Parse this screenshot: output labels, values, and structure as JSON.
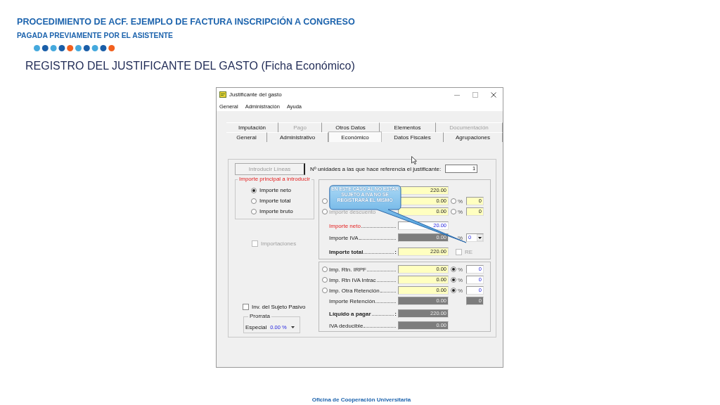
{
  "slide": {
    "title": "PROCEDIMIENTO DE ACF. EJEMPLO DE FACTURA INSCRIPCIÓN A CONGRESO",
    "subtitle": "PAGADA PREVIAMENTE POR EL ASISTENTE",
    "heading": "REGISTRO DEL JUSTIFICANTE DEL GASTO (Ficha Económico)",
    "footer": "Oficina de Cooperación Universitaria"
  },
  "window": {
    "title": "Justificante del gasto",
    "menu": [
      "General",
      "Administración",
      "Ayuda"
    ],
    "tab_rows": [
      [
        {
          "label": "Imputación",
          "selected": false,
          "disabled": false
        },
        {
          "label": "Pago",
          "selected": false,
          "disabled": true
        },
        {
          "label": "Otros Datos",
          "selected": false,
          "disabled": false
        },
        {
          "label": "Elementos",
          "selected": false,
          "disabled": false
        },
        {
          "label": "Documentación",
          "selected": false,
          "disabled": true
        }
      ],
      [
        {
          "label": "General",
          "selected": false,
          "disabled": false
        },
        {
          "label": "Administrativo",
          "selected": false,
          "disabled": false
        },
        {
          "label": "Económico",
          "selected": true,
          "disabled": false
        },
        {
          "label": "Datos Fiscales",
          "selected": false,
          "disabled": false
        },
        {
          "label": "Agrupaciones",
          "selected": false,
          "disabled": false
        }
      ]
    ],
    "lines_button": {
      "label": "Introducir Líneas",
      "disabled": true
    },
    "units": {
      "label": "Nº unidades a las que hace referencia el justificante:",
      "value": "1"
    },
    "main_amount": {
      "legend": "Importe principal a introducir",
      "options": [
        {
          "label": "Importe neto",
          "selected": true
        },
        {
          "label": "Importe total",
          "selected": false
        },
        {
          "label": "Importe bruto",
          "selected": false
        }
      ]
    },
    "imports": {
      "label": "Importaciones",
      "checked": false,
      "disabled": true
    },
    "reverse_charge": {
      "label": "Inv. del Sujeto Pasivo",
      "checked": false,
      "disabled": false
    },
    "prorrata": {
      "legend": "Prorrata",
      "label": "Especial",
      "value": "0.00 %"
    },
    "amounts": [
      {
        "amount": {
          "value": "220.00",
          "highlighted": true,
          "readonly": false
        }
      },
      {
        "radio": {
          "selected": false
        },
        "amount": {
          "value": "0.00",
          "highlighted": true,
          "readonly": false
        },
        "percent_radio": {
          "selected": false
        },
        "percent_label": "%",
        "percent_field": {
          "value": "0",
          "highlighted": true,
          "readonly": false
        }
      },
      {
        "radio": {
          "selected": false
        },
        "label": {
          "text": "Importe descuento",
          "required": false,
          "bold": false,
          "disabled": true
        },
        "amount": {
          "value": "0.00",
          "highlighted": true,
          "readonly": false
        },
        "percent_radio": {
          "selected": false
        },
        "percent_label": "%",
        "percent_field": {
          "value": "0",
          "highlighted": true,
          "readonly": false
        }
      },
      {
        "label": {
          "text": "Importe neto",
          "required": true,
          "bold": false,
          "disabled": false,
          "leader": true
        },
        "amount": {
          "value": "20.00",
          "highlighted": false,
          "readonly": false
        }
      },
      {
        "label": {
          "text": "Importe IVA",
          "required": false,
          "bold": false,
          "disabled": false,
          "leader": true
        },
        "amount": {
          "value": "0.00",
          "highlighted": false,
          "readonly": true
        },
        "percent_label": "%",
        "percent_dropdown": {
          "value": "0"
        }
      },
      {
        "label": {
          "text": "Importe total",
          "required": false,
          "bold": true,
          "disabled": false,
          "leader": true,
          "suffix": ":"
        },
        "amount": {
          "value": "220.00",
          "highlighted": true,
          "readonly": false
        },
        "check": {
          "label": "RE",
          "checked": false,
          "disabled": true
        }
      }
    ],
    "retentions": [
      {
        "radio": {
          "selected": false
        },
        "label": {
          "text": "Imp. Rtn. IRPF",
          "required": false,
          "bold": false,
          "disabled": false,
          "leader": true
        },
        "amount": {
          "value": "0.00",
          "highlighted": true,
          "readonly": false
        },
        "percent_radio": {
          "selected": true
        },
        "percent_label": "%",
        "percent_field": {
          "value": "0",
          "highlighted": false,
          "readonly": false
        }
      },
      {
        "radio": {
          "selected": false
        },
        "label": {
          "text": "Imp. Rtn IVA Intrac",
          "required": false,
          "bold": false,
          "disabled": false,
          "leader": true
        },
        "amount": {
          "value": "0.00",
          "highlighted": true,
          "readonly": false
        },
        "percent_radio": {
          "selected": true
        },
        "percent_label": "%",
        "percent_field": {
          "value": "0",
          "highlighted": false,
          "readonly": false
        }
      },
      {
        "radio": {
          "selected": false
        },
        "label": {
          "text": "Imp. Otra Retención",
          "required": false,
          "bold": false,
          "disabled": false,
          "leader": true
        },
        "amount": {
          "value": "0.00",
          "highlighted": true,
          "readonly": false
        },
        "percent_radio": {
          "selected": true
        },
        "percent_label": "%",
        "percent_field": {
          "value": "0",
          "highlighted": false,
          "readonly": false
        }
      },
      {
        "label": {
          "text": "Importe Retención",
          "required": false,
          "bold": false,
          "disabled": false,
          "leader": true
        },
        "amount": {
          "value": "0.00",
          "highlighted": false,
          "readonly": true
        },
        "percent_field": {
          "value": "0",
          "highlighted": false,
          "readonly": true
        }
      },
      {
        "label": {
          "text": "Líquido a pagar",
          "required": false,
          "bold": true,
          "disabled": false,
          "leader": true,
          "suffix": ":"
        },
        "amount": {
          "value": "220.00",
          "highlighted": false,
          "readonly": true
        }
      },
      {
        "label": {
          "text": "IVA deducible",
          "required": false,
          "bold": false,
          "disabled": false,
          "leader": true
        },
        "amount": {
          "value": "0.00",
          "highlighted": false,
          "readonly": true
        }
      }
    ],
    "callout": {
      "text": "EN ESTE CASO AL NO ESTAR SUJETO A IVA NO SE REGISTRARÁ EL MISMO"
    }
  }
}
